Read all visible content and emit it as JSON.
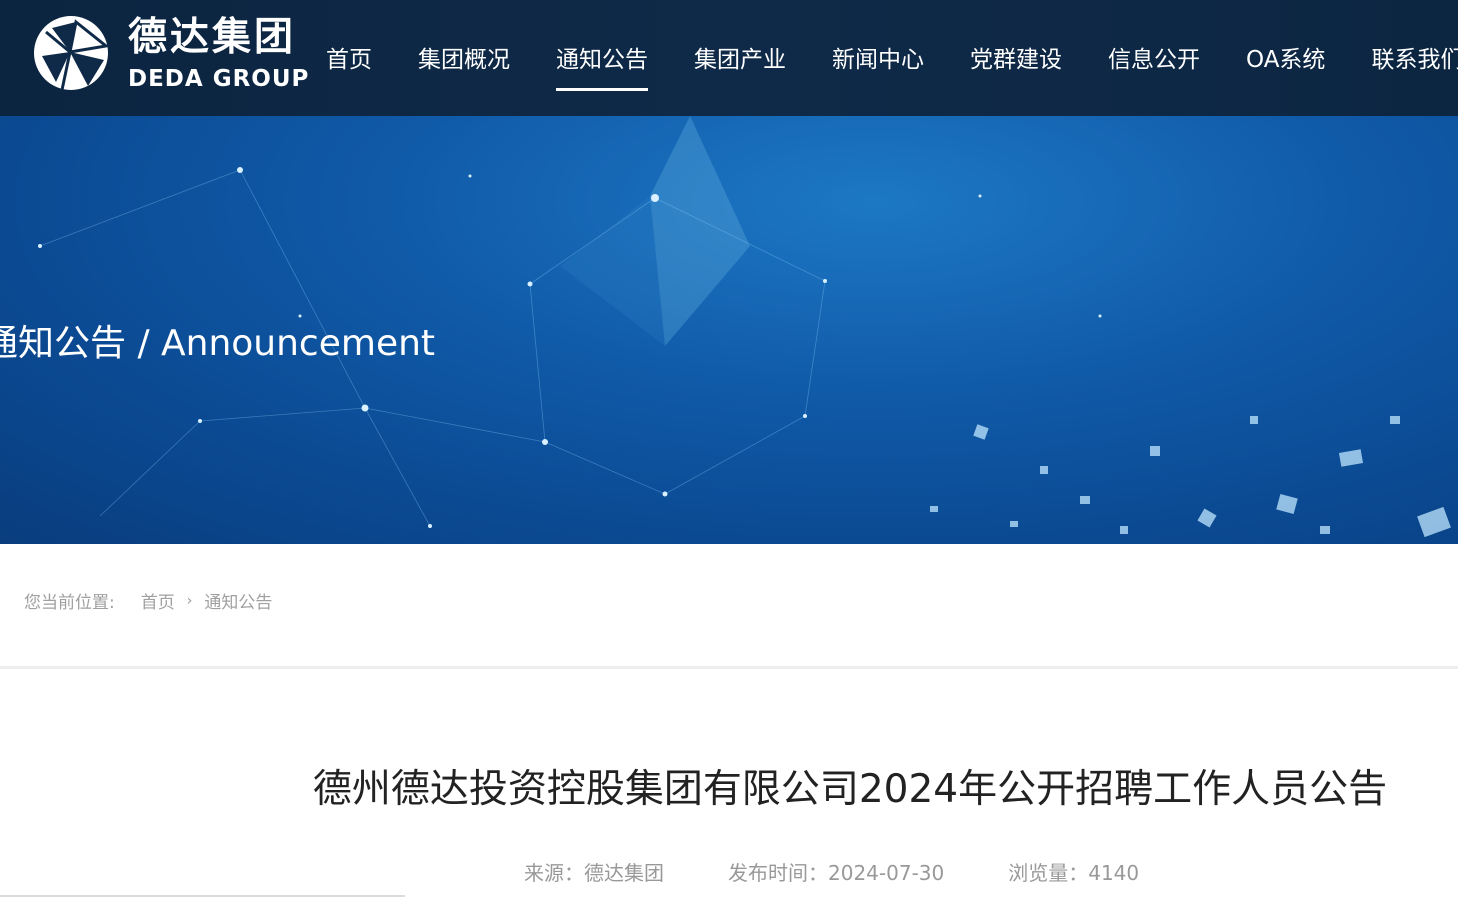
{
  "header": {
    "logo": {
      "cn": "德达集团",
      "en": "DEDA GROUP"
    },
    "nav": [
      {
        "label": "首页",
        "active": false
      },
      {
        "label": "集团概况",
        "active": false
      },
      {
        "label": "通知公告",
        "active": true
      },
      {
        "label": "集团产业",
        "active": false
      },
      {
        "label": "新闻中心",
        "active": false
      },
      {
        "label": "党群建设",
        "active": false
      },
      {
        "label": "信息公开",
        "active": false
      },
      {
        "label": "OA系统",
        "active": false
      },
      {
        "label": "联系我们",
        "active": false
      }
    ]
  },
  "banner": {
    "title": "通知公告 / Announcement"
  },
  "breadcrumb": {
    "label": "您当前位置:",
    "items": [
      "首页",
      "通知公告"
    ]
  },
  "article": {
    "title": "德州德达投资控股集团有限公司2024年公开招聘工作人员公告",
    "source_label": "来源：",
    "source": "德达集团",
    "date_label": "发布时间：",
    "date": "2024-07-30",
    "views_label": "浏览量：",
    "views": "4140"
  },
  "colors": {
    "header_bg": "#0f2a48",
    "banner_bg": "#105aa8",
    "text_muted": "#999999",
    "title_text": "#222222"
  }
}
